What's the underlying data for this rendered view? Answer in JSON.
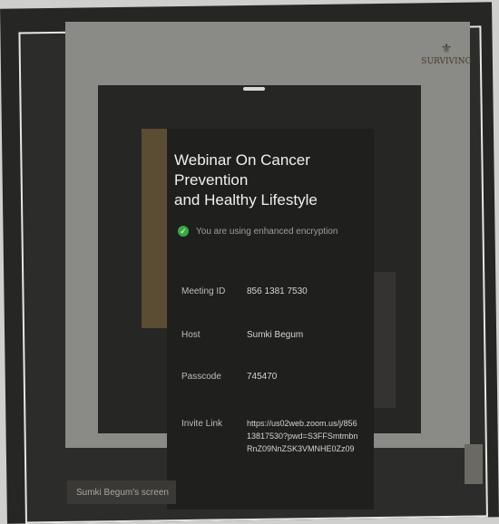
{
  "slide": {
    "logo_text": "SURVIVING",
    "title_line1": "Webinar On Cancer Prevention",
    "title_line2": "and Healthy Lifestyle",
    "encryption_text": "You are using enhanced encryption",
    "meeting_id_label": "Meeting ID",
    "meeting_id_value": "856 1381 7530",
    "host_label": "Host",
    "host_value": "Sumki Begum",
    "passcode_label": "Passcode",
    "passcode_value": "745470",
    "invite_link_label": "Invite Link",
    "invite_link_value": "https://us02web.zoom.us/j/85613817530?pwd=S3FFSmtmbnRnZ09NnZSK3VMNHE0Zz09",
    "status_text": "Sumki Begum's screen"
  },
  "colors": {
    "panel": "#262624",
    "card": "#1f1f1e",
    "check": "#39a845"
  }
}
